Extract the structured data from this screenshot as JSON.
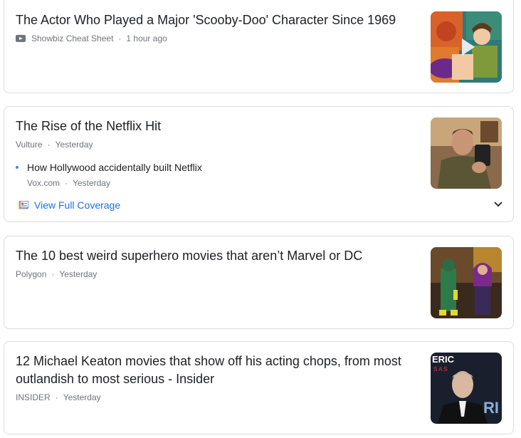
{
  "articles": [
    {
      "title": "The Actor Who Played a Major 'Scooby-Doo' Character Since 1969",
      "source": "Showbiz Cheat Sheet",
      "time": "1 hour ago",
      "thumb_icon": "play-icon"
    },
    {
      "title": "The Rise of the Netflix Hit",
      "source": "Vulture",
      "time": "Yesterday",
      "related": {
        "title": "How Hollywood accidentally built Netflix",
        "source": "Vox.com",
        "time": "Yesterday"
      },
      "coverage_label": "View Full Coverage"
    },
    {
      "title": "The 10 best weird superhero movies that aren’t Marvel or DC",
      "source": "Polygon",
      "time": "Yesterday"
    },
    {
      "title": "12 Michael Keaton movies that show off his acting chops, from most outlandish to most serious - Insider",
      "source": "INSIDER",
      "time": "Yesterday"
    }
  ],
  "colors": {
    "link_blue": "#1a73e8",
    "title": "#202124",
    "meta": "#70757a",
    "border": "#dadce0"
  }
}
